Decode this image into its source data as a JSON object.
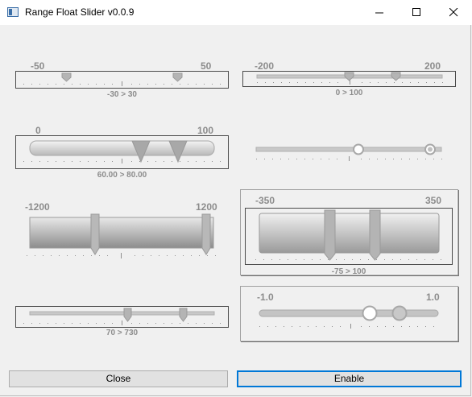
{
  "window": {
    "title": "Range Float Slider v0.0.9"
  },
  "sliders": [
    {
      "min": "-50",
      "max": "50",
      "range": "-30 > 30"
    },
    {
      "min": "-200",
      "max": "200",
      "range": "0 > 100"
    },
    {
      "min": "0",
      "max": "100",
      "range": "60.00 > 80.00"
    },
    {
      "min": "",
      "max": "",
      "range": ""
    },
    {
      "min": "-1200",
      "max": "1200",
      "range": ""
    },
    {
      "min": "-350",
      "max": "350",
      "range": "-75 > 100"
    },
    {
      "min": "",
      "max": "",
      "range": "70 > 730"
    },
    {
      "min": "-1.0",
      "max": "1.0",
      "range": ""
    }
  ],
  "buttons": {
    "close": "Close",
    "enable": "Enable"
  },
  "icons": [
    "app-icon",
    "minimize-icon",
    "maximize-icon",
    "close-icon"
  ]
}
